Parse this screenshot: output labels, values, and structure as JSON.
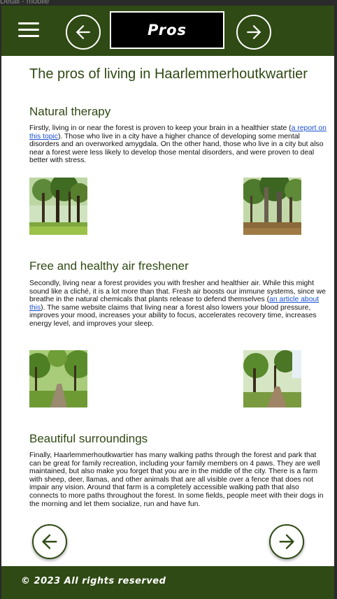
{
  "frame_label": "Detail - mobile",
  "header": {
    "title": "Pros",
    "menu_icon": "hamburger-menu-icon",
    "prev_icon": "arrow-left-icon",
    "next_icon": "arrow-right-icon"
  },
  "main": {
    "heading": "The pros of living in Haarlemmerhoutkwartier",
    "sections": [
      {
        "title": "Natural therapy",
        "text_before": "Firstly, living in or near the forest is proven to keep your brain in a healthier state (",
        "link": "a report on this topic",
        "text_after": "). Those who live in a city have a higher chance of developing some mental disorders and an overworked amygdala. On the other hand, those who live in a city but also near a forest were less likely to develop those mental disorders, and were proven to deal better with stress."
      },
      {
        "title": "Free and healthy air freshener",
        "text_before": "Secondly, living near a forest provides you with fresher and healthier air. While this might sound like a cliché, it is a lot more than that. Fresh air boosts our immune systems, since we breathe in the natural chemicals that plants release to defend themselves (",
        "link": "an article about this",
        "text_after": "). The same website claims that living near a forest also lowers your blood pressure, improves your mood, increases your ability to focus, accelerates recovery time, increases energy level, and improves your sleep."
      },
      {
        "title": "Beautiful surroundings",
        "text": "Finally, Haarlemmerhoutkwartier has many walking paths through the forest and park that can be great for family recreation, including your family members on 4 paws. They are well maintained, but also make you forget that you are in the middle of the city. There is a farm with sheep, deer, llamas, and other animals that are all visible over a fence that does not impair any vision. Around that farm is a completely accessible walking path that also connects to more paths throughout the forest. In some fields, people meet with their dogs in the morning and let them socialize, run and have fun."
      }
    ]
  },
  "bottom_nav": {
    "prev_icon": "arrow-left-icon",
    "next_icon": "arrow-right-icon"
  },
  "footer": {
    "text": "© 2023 All rights reserved"
  },
  "colors": {
    "brand_green": "#2f4a14",
    "link_blue": "#1a4fd1"
  }
}
